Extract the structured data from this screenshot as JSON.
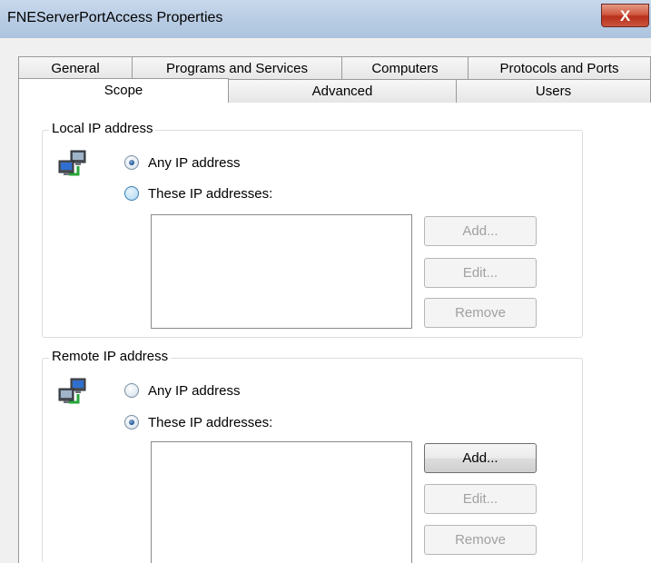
{
  "window": {
    "title": "FNEServerPortAccess Properties",
    "close_glyph": "X"
  },
  "tabs_row1": [
    {
      "label": "General"
    },
    {
      "label": "Programs and Services"
    },
    {
      "label": "Computers"
    },
    {
      "label": "Protocols and Ports"
    }
  ],
  "tabs_row2": [
    {
      "label": "Scope",
      "selected": true
    },
    {
      "label": "Advanced"
    },
    {
      "label": "Users"
    }
  ],
  "local": {
    "legend": "Local IP address",
    "icon": "network-computers-icon",
    "any_label": "Any IP address",
    "these_label": "These IP addresses:",
    "selected": "any",
    "buttons": {
      "add": "Add...",
      "edit": "Edit...",
      "remove": "Remove"
    }
  },
  "remote": {
    "legend": "Remote IP address",
    "icon": "network-computers-icon",
    "any_label": "Any IP address",
    "these_label": "These IP addresses:",
    "selected": "these",
    "buttons": {
      "add": "Add...",
      "edit": "Edit...",
      "remove": "Remove"
    }
  },
  "colors": {
    "titlebar": "#b7cbe3",
    "close": "#c9553d",
    "radio_dot": "#1a4f93"
  }
}
